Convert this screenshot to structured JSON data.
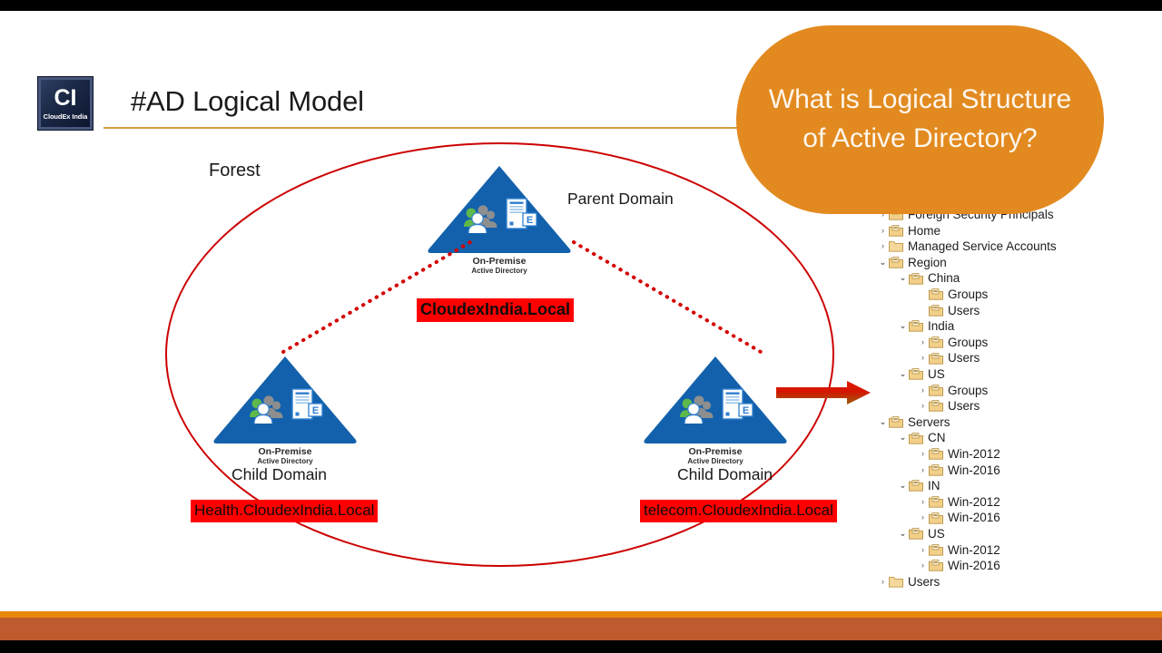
{
  "slide": {
    "title": "#AD Logical Model",
    "logo": {
      "initials": "CI",
      "name": "CloudEx India"
    }
  },
  "callout": {
    "text": "What is Logical Structure of Active Directory?",
    "color": "#e28a20"
  },
  "diagram": {
    "forest_label": "Forest",
    "ellipse_color": "#cc0000",
    "domains": [
      {
        "id": "parent",
        "role_label": "Parent Domain",
        "caption_line1": "On-Premise",
        "caption_line2": "Active Directory",
        "fqdn": "CloudexIndia.Local",
        "fqdn_highlight": "#ff0000"
      },
      {
        "id": "child-left",
        "role_label": "Child Domain",
        "caption_line1": "On-Premise",
        "caption_line2": "Active Directory",
        "fqdn": "Health.CloudexIndia.Local",
        "fqdn_highlight": "#ff0000"
      },
      {
        "id": "child-right",
        "role_label": "Child Domain",
        "caption_line1": "On-Premise",
        "caption_line2": "Active Directory",
        "fqdn": "telecom.CloudexIndia.Local",
        "fqdn_highlight": "#ff0000"
      }
    ]
  },
  "ad_tree": {
    "items": [
      {
        "label": "Foreign Security Principals",
        "depth": 0,
        "state": "collapsed",
        "icon": "ou-folder-icon",
        "occluded": true
      },
      {
        "label": "Home",
        "depth": 0,
        "state": "collapsed",
        "icon": "ou-folder-icon"
      },
      {
        "label": "Managed Service Accounts",
        "depth": 0,
        "state": "collapsed",
        "icon": "plain-folder-icon"
      },
      {
        "label": "Region",
        "depth": 0,
        "state": "expanded",
        "icon": "ou-folder-icon"
      },
      {
        "label": "China",
        "depth": 1,
        "state": "expanded",
        "icon": "ou-folder-icon"
      },
      {
        "label": "Groups",
        "depth": 2,
        "state": "leaf",
        "icon": "ou-folder-icon"
      },
      {
        "label": "Users",
        "depth": 2,
        "state": "leaf",
        "icon": "ou-folder-icon"
      },
      {
        "label": "India",
        "depth": 1,
        "state": "expanded",
        "icon": "ou-folder-icon"
      },
      {
        "label": "Groups",
        "depth": 2,
        "state": "collapsed",
        "icon": "ou-folder-icon"
      },
      {
        "label": "Users",
        "depth": 2,
        "state": "collapsed",
        "icon": "ou-folder-icon"
      },
      {
        "label": "US",
        "depth": 1,
        "state": "expanded",
        "icon": "ou-folder-icon"
      },
      {
        "label": "Groups",
        "depth": 2,
        "state": "collapsed",
        "icon": "ou-folder-icon"
      },
      {
        "label": "Users",
        "depth": 2,
        "state": "collapsed",
        "icon": "ou-folder-icon"
      },
      {
        "label": "Servers",
        "depth": 0,
        "state": "expanded",
        "icon": "ou-folder-icon"
      },
      {
        "label": "CN",
        "depth": 1,
        "state": "expanded",
        "icon": "ou-folder-icon"
      },
      {
        "label": "Win-2012",
        "depth": 2,
        "state": "collapsed",
        "icon": "ou-folder-icon"
      },
      {
        "label": "Win-2016",
        "depth": 2,
        "state": "collapsed",
        "icon": "ou-folder-icon"
      },
      {
        "label": "IN",
        "depth": 1,
        "state": "expanded",
        "icon": "ou-folder-icon"
      },
      {
        "label": "Win-2012",
        "depth": 2,
        "state": "collapsed",
        "icon": "ou-folder-icon"
      },
      {
        "label": "Win-2016",
        "depth": 2,
        "state": "collapsed",
        "icon": "ou-folder-icon"
      },
      {
        "label": "US",
        "depth": 1,
        "state": "expanded",
        "icon": "ou-folder-icon"
      },
      {
        "label": "Win-2012",
        "depth": 2,
        "state": "collapsed",
        "icon": "ou-folder-icon"
      },
      {
        "label": "Win-2016",
        "depth": 2,
        "state": "collapsed",
        "icon": "ou-folder-icon"
      },
      {
        "label": "Users",
        "depth": 0,
        "state": "collapsed",
        "icon": "plain-folder-icon"
      }
    ],
    "chevron_collapsed": "›",
    "chevron_expanded": "⌄"
  },
  "footer": {
    "text": "",
    "orange": "#e8890c",
    "brown": "#bd5a2e"
  }
}
